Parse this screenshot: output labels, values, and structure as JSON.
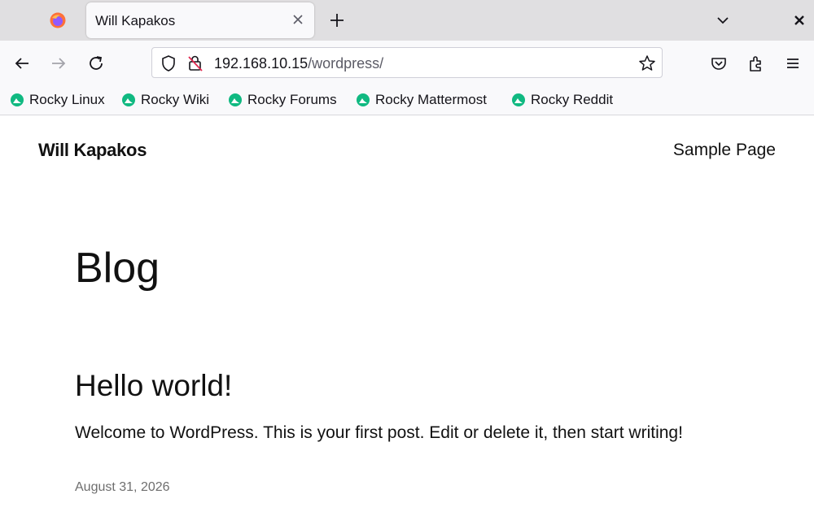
{
  "browser": {
    "tab": {
      "title": "Will Kapakos"
    },
    "url": {
      "host": "192.168.10.15",
      "path": "/wordpress/"
    },
    "bookmarks": [
      {
        "label": "Rocky Linux"
      },
      {
        "label": "Rocky Wiki"
      },
      {
        "label": "Rocky Forums"
      },
      {
        "label": "Rocky Mattermost"
      },
      {
        "label": "Rocky Reddit"
      }
    ],
    "colors": {
      "tabbar": "#e0dfe1",
      "toolbar": "#f9f9fb",
      "rocky_green": "#10b981"
    }
  },
  "site": {
    "title": "Will Kapakos",
    "nav": [
      {
        "label": "Sample Page"
      }
    ]
  },
  "main": {
    "heading": "Blog",
    "posts": [
      {
        "title": "Hello world!",
        "excerpt": "Welcome to WordPress. This is your first post. Edit or delete it, then start writing!",
        "date": "August 31, 2026"
      }
    ]
  }
}
